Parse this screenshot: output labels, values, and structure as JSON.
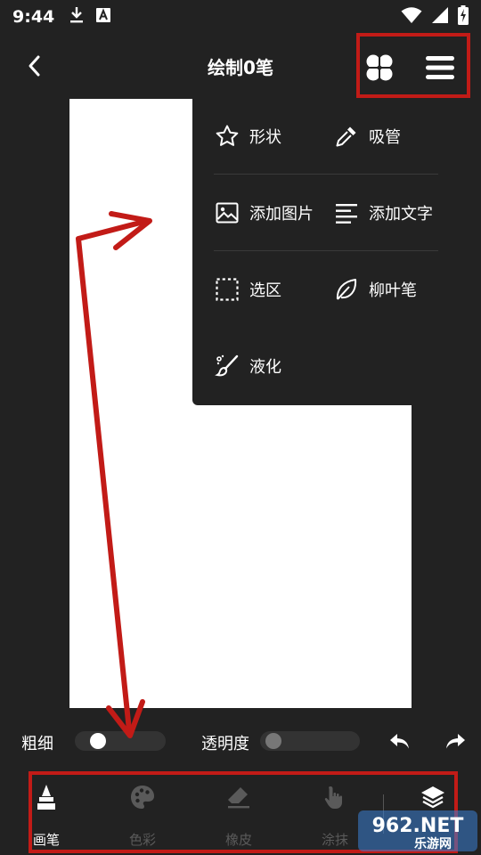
{
  "status_bar": {
    "time": "9:44",
    "icons": [
      "download-icon",
      "a-notification-icon",
      "wifi-icon",
      "signal-icon",
      "battery-charging-icon"
    ]
  },
  "header": {
    "title": "绘制0笔",
    "back_icon": "chevron-left-icon",
    "tools_icon": "four-petal-icon",
    "menu_icon": "hamburger-menu-icon"
  },
  "dropdown": {
    "items": [
      {
        "label": "形状",
        "icon": "star-icon"
      },
      {
        "label": "吸管",
        "icon": "eyedropper-icon"
      },
      {
        "label": "添加图片",
        "icon": "image-icon"
      },
      {
        "label": "添加文字",
        "icon": "text-lines-icon"
      },
      {
        "label": "选区",
        "icon": "dashed-selection-icon"
      },
      {
        "label": "柳叶笔",
        "icon": "leaf-icon"
      },
      {
        "label": "液化",
        "icon": "liquify-brush-icon"
      }
    ]
  },
  "sliders": {
    "thickness_label": "粗细",
    "thickness_value": 0.15,
    "opacity_label": "透明度",
    "opacity_value": 0.0
  },
  "toolbar": {
    "tools": [
      {
        "label": "画笔",
        "icon": "brush-icon",
        "active": true
      },
      {
        "label": "色彩",
        "icon": "palette-icon",
        "active": false
      },
      {
        "label": "橡皮",
        "icon": "eraser-icon",
        "active": false
      },
      {
        "label": "涂抹",
        "icon": "finger-smudge-icon",
        "active": false
      },
      {
        "label": "",
        "icon": "layers-icon",
        "active": true
      }
    ]
  },
  "watermark": {
    "brand": "962.NET",
    "tagline": "乐游网"
  },
  "colors": {
    "background": "#222222",
    "canvas": "#ffffff",
    "annotation_red": "#c21b17",
    "inactive_tool": "#5a5a5a",
    "text": "#ffffff"
  }
}
